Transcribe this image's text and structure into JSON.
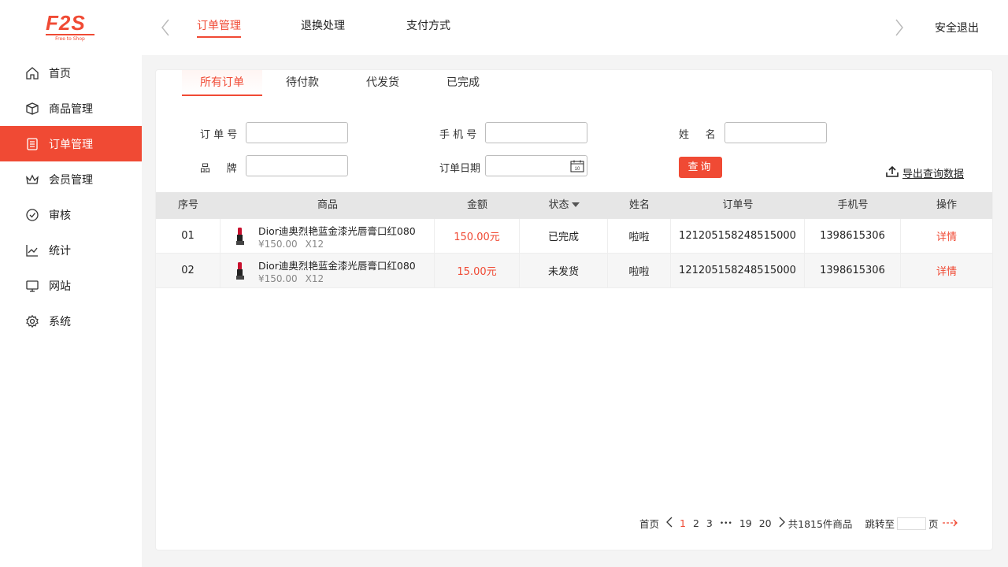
{
  "brand": {
    "logo_text": "F2S",
    "logo_sub": "Free to Shop",
    "accent": "#f04a34"
  },
  "sidebar": {
    "items": [
      {
        "label": "首页",
        "icon": "home-icon"
      },
      {
        "label": "商品管理",
        "icon": "box-icon"
      },
      {
        "label": "订单管理",
        "icon": "order-list-icon",
        "active": true
      },
      {
        "label": "会员管理",
        "icon": "crown-icon"
      },
      {
        "label": "审核",
        "icon": "check-circle-icon"
      },
      {
        "label": "统计",
        "icon": "line-chart-icon"
      },
      {
        "label": "网站",
        "icon": "monitor-icon"
      },
      {
        "label": "系统",
        "icon": "gear-icon"
      }
    ]
  },
  "topbar": {
    "tabs": [
      "订单管理",
      "退换处理",
      "支付方式"
    ],
    "active_tab": 0,
    "logout": "安全退出"
  },
  "order_tabs": [
    "所有订单",
    "待付款",
    "代发货",
    "已完成"
  ],
  "filters": {
    "order_no_label": "订 单 号",
    "phone_label": "手 机 号",
    "name_label": "姓     名",
    "brand_label": "品     牌",
    "date_label": "订单日期",
    "calendar_day": "10",
    "search_button": "查询",
    "export": "导出查询数据"
  },
  "table": {
    "headers": [
      "序号",
      "商品",
      "金额",
      "状态",
      "姓名",
      "订单号",
      "手机号",
      "操作"
    ],
    "rows": [
      {
        "index": "01",
        "product": "Dior迪奥烈艳蓝金漆光唇膏口红080",
        "price": "¥150.00",
        "qty": "X12",
        "amount": "150.00元",
        "status": "已完成",
        "name": "啦啦",
        "order_no": "121205158248515000",
        "phone": "1398615306",
        "action": "详情"
      },
      {
        "index": "02",
        "product": "Dior迪奥烈艳蓝金漆光唇膏口红080",
        "price": "¥150.00",
        "qty": "X12",
        "amount": "15.00元",
        "status": "未发货",
        "name": "啦啦",
        "order_no": "121205158248515000",
        "phone": "1398615306",
        "action": "详情"
      }
    ]
  },
  "pagination": {
    "first": "首页",
    "pages": [
      "1",
      "2",
      "3"
    ],
    "ellipsis": "•••",
    "tail_pages": [
      "19",
      "20"
    ],
    "total": "共1815件商品",
    "jump_label": "跳转至",
    "page_unit": "页",
    "current": "1"
  }
}
